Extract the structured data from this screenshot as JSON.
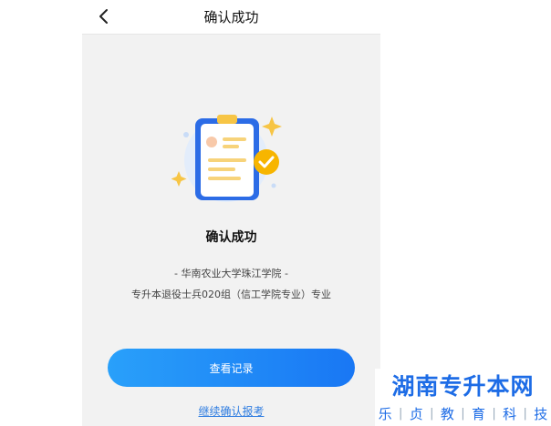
{
  "header": {
    "title": "确认成功"
  },
  "status": {
    "title": "确认成功",
    "school": "- 华南农业大学珠江学院 -",
    "major": "专升本退役士兵020组（信工学院专业）专业"
  },
  "actions": {
    "view_records": "查看记录",
    "continue_confirm": "继续确认报考"
  },
  "watermark": {
    "title": "湖南专升本网",
    "chars": [
      "乐",
      "贞",
      "教",
      "育",
      "科",
      "技"
    ]
  },
  "colors": {
    "accent": "#1977f4",
    "button_gradient_start": "#29a0fa",
    "link": "#2f7de1",
    "check": "#f7b500"
  }
}
